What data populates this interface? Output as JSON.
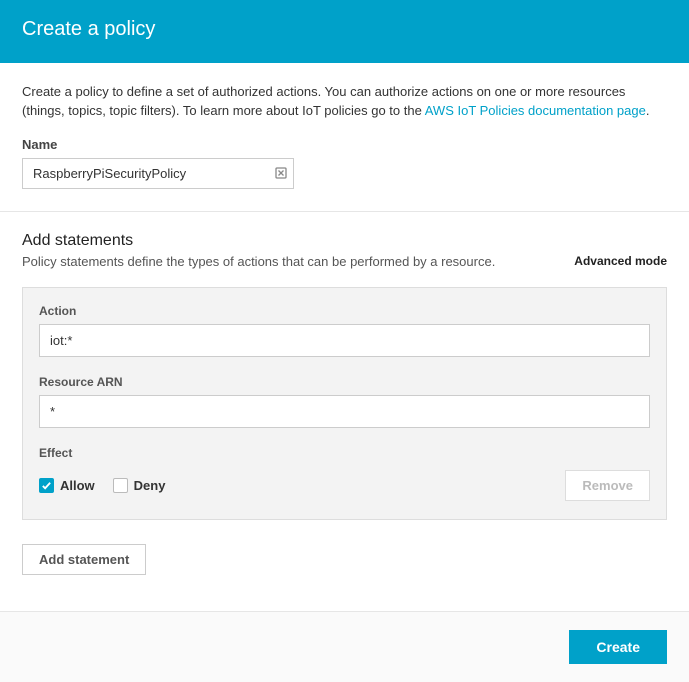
{
  "header": {
    "title": "Create a policy"
  },
  "intro": {
    "text_before": "Create a policy to define a set of authorized actions. You can authorize actions on one or more resources (things, topics, topic filters). To learn more about IoT policies go to the ",
    "link_text": "AWS IoT Policies documentation page",
    "text_after": "."
  },
  "name": {
    "label": "Name",
    "value": "RaspberryPiSecurityPolicy"
  },
  "statements": {
    "heading": "Add statements",
    "description": "Policy statements define the types of actions that can be performed by a resource.",
    "advanced_mode": "Advanced mode",
    "action_label": "Action",
    "action_value": "iot:*",
    "resource_label": "Resource ARN",
    "resource_value": "*",
    "effect_label": "Effect",
    "allow_label": "Allow",
    "allow_checked": true,
    "deny_label": "Deny",
    "deny_checked": false,
    "remove_label": "Remove",
    "add_label": "Add statement"
  },
  "footer": {
    "create_label": "Create"
  }
}
